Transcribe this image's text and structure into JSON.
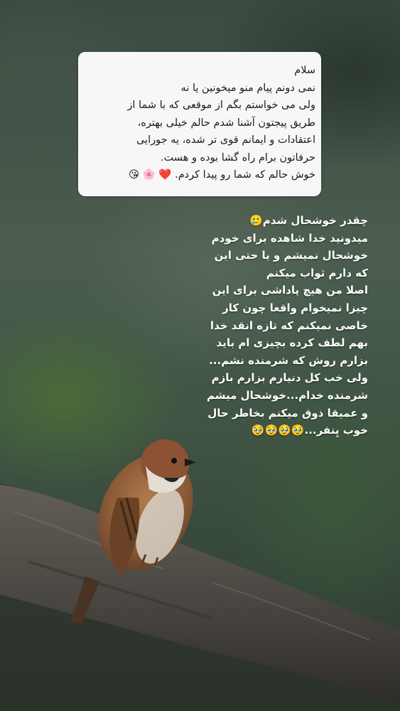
{
  "message_card": {
    "lines": [
      "سلام",
      "نمی دونم پیام منو میخونین یا نه",
      "ولی می خواستم بگم از موقعی که با شما از",
      "طریق پیجتون آشنا شدم حالم خیلی بهتره،",
      "اعتقادات و ایمانم قوی تر شده، یه جورایی",
      "حرفاتون برام راه گشا بوده و هست.",
      "خوش حالم که شما رو پیدا کردم. ❤️ 🌸 😘"
    ]
  },
  "caption": {
    "lines": [
      "چقدر خوشحال شدم🥲",
      "میدونید خدا شاهده برای خودم",
      "خوشحال نمیشم و یا حتی این",
      "که دارم ثواب میکنم",
      "اصلا من هیچ پاداشی برای این",
      "چیزا نمیخوام واقعا چون کار",
      "خاصی نمیکنم که تازه انقد خدا",
      "بهم لطف کرده بچیزی ام باید",
      "بزارم روش که شرمنده نشم...",
      "ولی خب کل دنیارم بزارم بازم",
      "شرمنده خدام...خوشحال میشم",
      "و عمیقا ذوق میکنم بخاطر حال",
      "خوب یِنفر...🥹🥹🥹🥹"
    ]
  },
  "background": {
    "subject": "sparrow-on-branch",
    "colors": {
      "foliage": "#4a6e36",
      "dark_green": "#2d3a2f",
      "branch": "#4b4843",
      "bird_brown": "#8a4f2e"
    }
  }
}
